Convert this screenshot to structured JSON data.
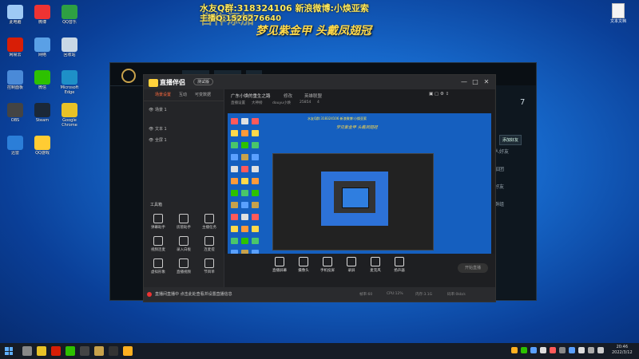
{
  "overlay": {
    "line1": "水友Q群:318324106 新浪微博:小焕亚索",
    "line2": "主播Q:1526276640",
    "line3": "合作添加",
    "line4": "梦见紫金甲 头戴凤翅冠"
  },
  "desktop": {
    "icons": [
      {
        "label": "此电脑",
        "color": "#9ec9f5"
      },
      {
        "label": "微博",
        "color": "#e33"
      },
      {
        "label": "QQ音乐",
        "color": "#2ea043"
      },
      {
        "label": "网易云",
        "color": "#d81e06"
      },
      {
        "label": "网络",
        "color": "#5aa0e6"
      },
      {
        "label": "回收站",
        "color": "#c9d8e6"
      },
      {
        "label": "控制面板",
        "color": "#4a8ad8"
      },
      {
        "label": "微信",
        "color": "#2dc100"
      },
      {
        "label": "Microsoft Edge",
        "color": "#1e90c8"
      },
      {
        "label": "OBS",
        "color": "#444"
      },
      {
        "label": "Steam",
        "color": "#1b2838"
      },
      {
        "label": "Google Chrome",
        "color": "#e8c227"
      },
      {
        "label": "迅雷",
        "color": "#2b7ed8"
      },
      {
        "label": "QQ游戏",
        "color": "#ffcc33"
      }
    ],
    "corner_file": "文本文档"
  },
  "lol": {
    "count": "7",
    "tooltip": "添加好友",
    "side_texts": [
      "人好友",
      "加团",
      "好友",
      "群组"
    ]
  },
  "app": {
    "name": "直播伴侣",
    "badge": "测试版",
    "left_tabs": [
      "场景设置",
      "互动",
      "可变数据"
    ],
    "scenes": [
      "场景 1",
      "文本 1",
      "全屏 1"
    ],
    "tools_label": "工具箱",
    "tools": [
      "弹幕助手",
      "房管助手",
      "主播任务",
      "视频连麦",
      "录入白板",
      "连麦提",
      "虚拟形象",
      "直播视频",
      "节目单"
    ],
    "room_title": "广东小焕的重生之路",
    "edit_label": "修改",
    "category": "英雄联盟",
    "room_sub": [
      "直播设置",
      "大神榜",
      "douyu小焕",
      "25854",
      "4"
    ],
    "bottom_tools": [
      "直播屏幕",
      "摄像头",
      "手机投屏",
      "录屏",
      "麦克风",
      "扬声器"
    ],
    "start_button": "开始直播",
    "status_msg": "直播间直播中 点击此处查看并设置直播信息",
    "stats": [
      "帧率:60",
      "CPU:12%",
      "内存:3.1G",
      "码率:0kb/s"
    ]
  },
  "taskbar": {
    "time": "20:46",
    "date": "2022/3/12"
  }
}
